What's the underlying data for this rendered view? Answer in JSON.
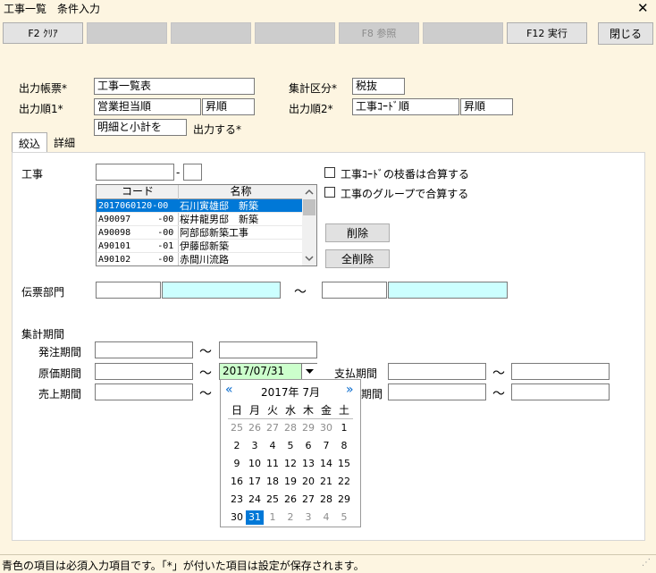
{
  "window": {
    "title": "工事一覧　条件入力",
    "close_glyph": "✕"
  },
  "fkeys": [
    {
      "label": "F2 ｸﾘｱ",
      "state": "enabled"
    },
    {
      "label": "",
      "state": "blank"
    },
    {
      "label": "",
      "state": "blank"
    },
    {
      "label": "",
      "state": "blank"
    },
    {
      "label": "F8 参照",
      "state": "disabled"
    },
    {
      "label": "",
      "state": "blank"
    },
    {
      "label": "F12 実行",
      "state": "enabled"
    }
  ],
  "close_button": "閉じる",
  "form": {
    "report_label": "出力帳票*",
    "report_value": "工事一覧表",
    "tally_label": "集計区分*",
    "tally_value": "税抜",
    "order1_label": "出力順1*",
    "order1_value": "営業担当順",
    "order1_dir": "昇順",
    "order2_label": "出力順2*",
    "order2_value": "工事ｺｰﾄﾞ順",
    "order2_dir": "昇順",
    "detail_value": "明細と小計を",
    "detail_label": "出力する*"
  },
  "tabs": [
    {
      "label": "絞込",
      "active": true
    },
    {
      "label": "詳細",
      "active": false
    }
  ],
  "filter": {
    "koji_label": "工事",
    "dash": "-",
    "check1": "工事ｺｰﾄﾞの枝番は合算する",
    "check2": "工事のグループで合算する",
    "list_headers": [
      "コード",
      "名称"
    ],
    "list_rows": [
      {
        "code": "2017060120-00",
        "name": "石川寅雄邸　新築",
        "selected": true
      },
      {
        "code": "A90097     -00",
        "name": "桜井龍男邸　新築",
        "selected": false
      },
      {
        "code": "A90098     -00",
        "name": "阿部邸新築工事",
        "selected": false
      },
      {
        "code": "A90101     -01",
        "name": "伊藤邸新築",
        "selected": false
      },
      {
        "code": "A90102     -00",
        "name": "赤間川流路",
        "selected": false
      }
    ],
    "delete_button": "削除",
    "delete_all_button": "全削除",
    "dept_label": "伝票部門",
    "tilde": "～",
    "period_section": "集計期間",
    "order_period": "発注期間",
    "cost_period": "原価期間",
    "cost_to_value": "2017/07/31",
    "pay_period": "支払期間",
    "sales_period": "売上期間",
    "second_right_label": "期間"
  },
  "calendar": {
    "prev": "«",
    "next": "»",
    "month_title": "2017年 7月",
    "weekdays": [
      "日",
      "月",
      "火",
      "水",
      "木",
      "金",
      "土"
    ],
    "weeks": [
      [
        "25",
        "26",
        "27",
        "28",
        "29",
        "30",
        "1"
      ],
      [
        "2",
        "3",
        "4",
        "5",
        "6",
        "7",
        "8"
      ],
      [
        "9",
        "10",
        "11",
        "12",
        "13",
        "14",
        "15"
      ],
      [
        "16",
        "17",
        "18",
        "19",
        "20",
        "21",
        "22"
      ],
      [
        "23",
        "24",
        "25",
        "26",
        "27",
        "28",
        "29"
      ],
      [
        "30",
        "31",
        "1",
        "2",
        "3",
        "4",
        "5"
      ]
    ],
    "today": "31"
  },
  "status": "青色の項目は必須入力項目です。「*」が付いた項目は設定が保存されます。",
  "colors": {
    "background": "#fdf5e1",
    "selection": "#0078d7",
    "required_field": "#ccffff",
    "active_date_field": "#ccffcc"
  }
}
